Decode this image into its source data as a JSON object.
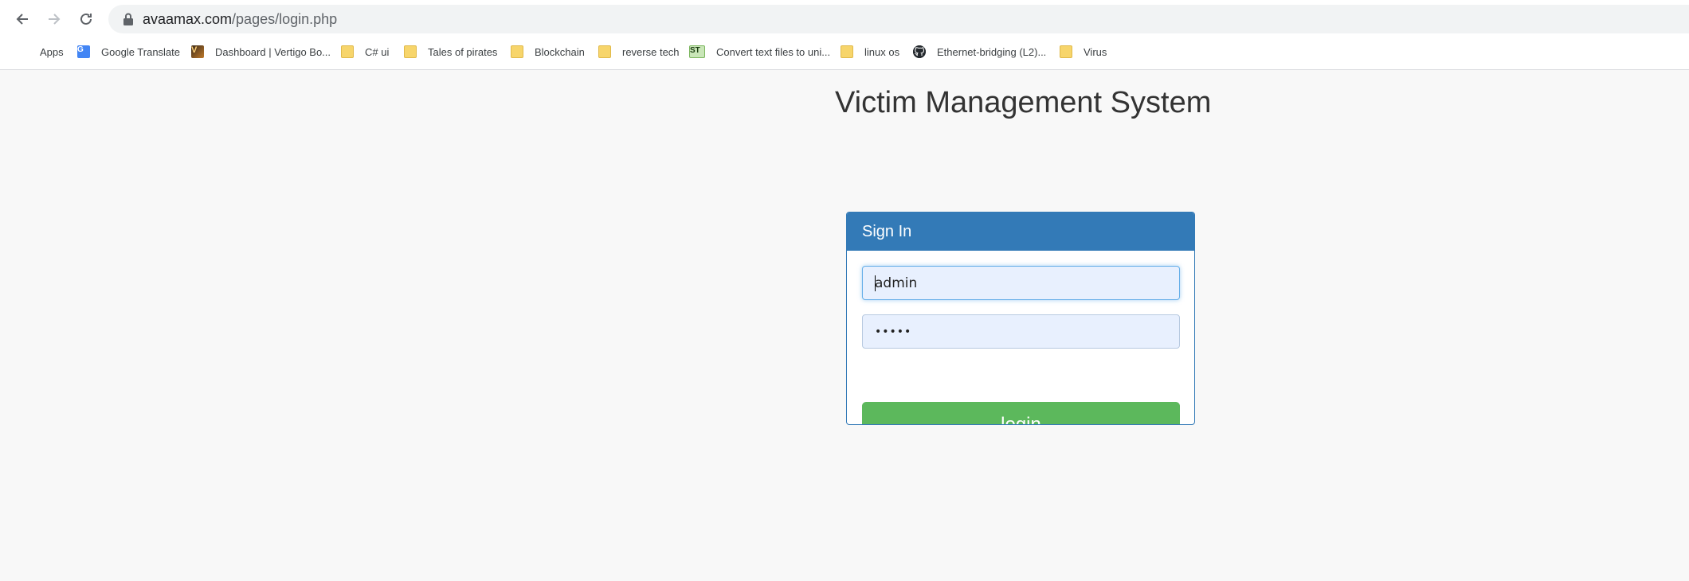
{
  "browser": {
    "url_domain": "avaamax.com",
    "url_path": "/pages/login.php",
    "bookmarks": [
      {
        "label": "Apps",
        "icon": "apps-grid-icon"
      },
      {
        "label": "Google Translate",
        "icon": "google-translate-icon"
      },
      {
        "label": "Dashboard | Vertigo Bo...",
        "icon": "vertigo-icon"
      },
      {
        "label": "C# ui",
        "icon": "folder-icon"
      },
      {
        "label": "Tales of pirates",
        "icon": "folder-icon"
      },
      {
        "label": "Blockchain",
        "icon": "folder-icon"
      },
      {
        "label": "reverse tech",
        "icon": "folder-icon"
      },
      {
        "label": "Convert text files to uni...",
        "icon": "st-icon"
      },
      {
        "label": "linux os",
        "icon": "folder-icon"
      },
      {
        "label": "Ethernet-bridging (L2)...",
        "icon": "github-icon"
      },
      {
        "label": "Virus",
        "icon": "folder-icon"
      }
    ],
    "st_icon_text": "ST",
    "gt_icon_text": "G",
    "vb_icon_text": "V"
  },
  "page": {
    "title": "Victim Management System",
    "panel_heading": "Sign In",
    "username_value": "admin",
    "password_value": "•••••",
    "login_label": "login"
  },
  "colors": {
    "primary": "#337ab7",
    "success": "#5cb85c",
    "autofill_bg": "#e8f0fe"
  }
}
